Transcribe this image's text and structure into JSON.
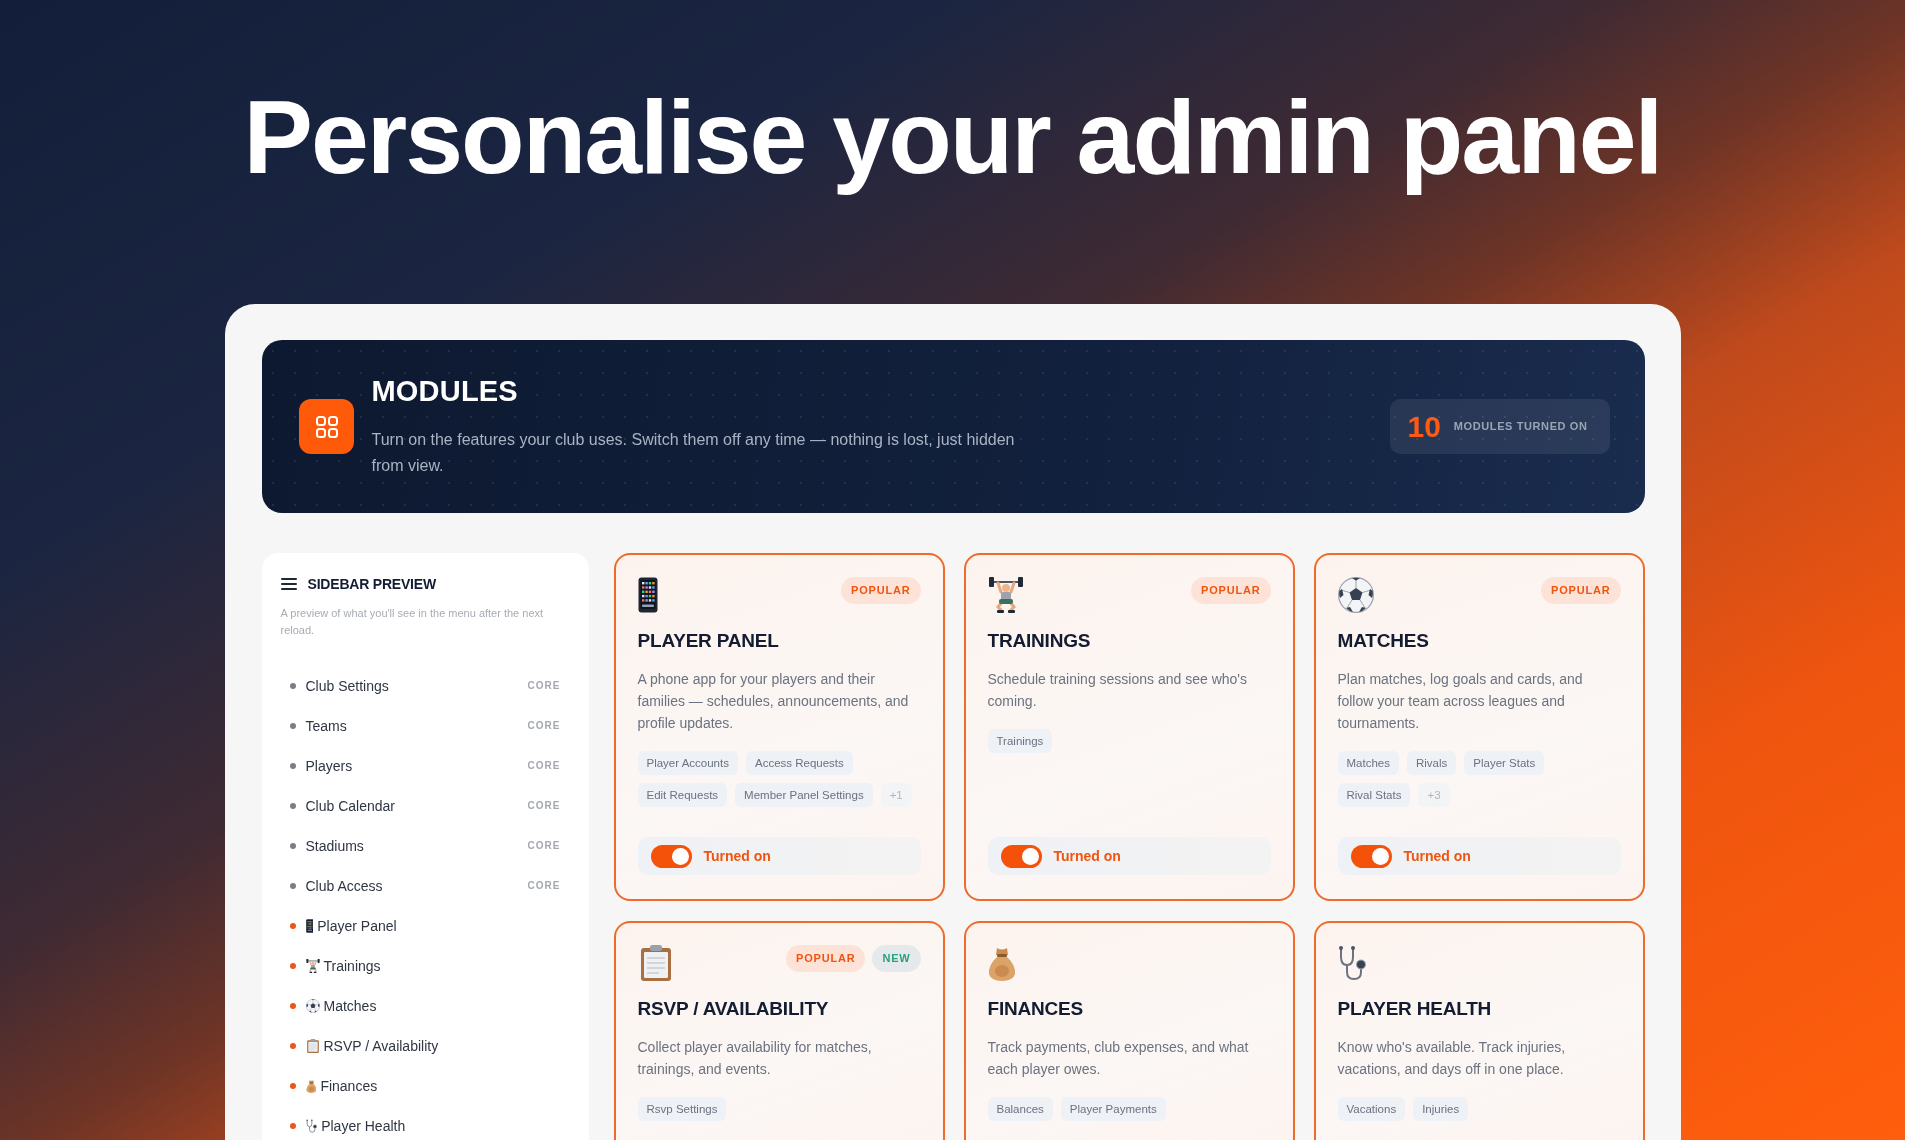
{
  "headline": "Personalise your admin panel",
  "banner": {
    "title": "MODULES",
    "description": "Turn on the features your club uses. Switch them off any time — nothing is lost, just hidden from view.",
    "count": "10",
    "count_label": "MODULES TURNED ON"
  },
  "sidebar": {
    "title": "SIDEBAR PREVIEW",
    "description": "A preview of what you'll see in the menu after the next reload.",
    "items": [
      {
        "label": "Club Settings",
        "kind": "core",
        "badge": "CORE",
        "color": "#7a7f87"
      },
      {
        "label": "Teams",
        "kind": "core",
        "badge": "CORE",
        "color": "#7a7f87"
      },
      {
        "label": "Players",
        "kind": "core",
        "badge": "CORE",
        "color": "#7a7f87"
      },
      {
        "label": "Club Calendar",
        "kind": "core",
        "badge": "CORE",
        "color": "#7a7f87"
      },
      {
        "label": "Stadiums",
        "kind": "core",
        "badge": "CORE",
        "color": "#7a7f87"
      },
      {
        "label": "Club Access",
        "kind": "core",
        "badge": "CORE",
        "color": "#7a7f87"
      },
      {
        "label": "Player Panel",
        "kind": "module",
        "color": "#f0541a"
      },
      {
        "label": "Trainings",
        "kind": "module",
        "color": "#f0541a"
      },
      {
        "label": "Matches",
        "kind": "module",
        "color": "#f0541a"
      },
      {
        "label": "RSVP / Availability",
        "kind": "module",
        "color": "#f0541a"
      },
      {
        "label": "Finances",
        "kind": "module",
        "color": "#f0541a"
      },
      {
        "label": "Player Health",
        "kind": "module",
        "color": "#f0541a"
      }
    ]
  },
  "modules": [
    {
      "title": "PLAYER PANEL",
      "badges": [
        {
          "label": "POPULAR",
          "kind": "popular"
        }
      ],
      "description": "A phone app for your players and their families — schedules, announcements, and profile updates.",
      "tags": [
        "Player Accounts",
        "Access Requests",
        "Edit Requests",
        "Member Panel Settings"
      ],
      "more_tags": "+1",
      "toggle": {
        "on": true,
        "label": "Turned on"
      }
    },
    {
      "title": "TRAININGS",
      "badges": [
        {
          "label": "POPULAR",
          "kind": "popular"
        }
      ],
      "description": "Schedule training sessions and see who's coming.",
      "tags": [
        "Trainings"
      ],
      "toggle": {
        "on": true,
        "label": "Turned on"
      }
    },
    {
      "title": "MATCHES",
      "badges": [
        {
          "label": "POPULAR",
          "kind": "popular"
        }
      ],
      "description": "Plan matches, log goals and cards, and follow your team across leagues and tournaments.",
      "tags": [
        "Matches",
        "Rivals",
        "Player Stats",
        "Rival Stats"
      ],
      "more_tags": "+3",
      "toggle": {
        "on": true,
        "label": "Turned on"
      }
    },
    {
      "title": "RSVP / AVAILABILITY",
      "badges": [
        {
          "label": "POPULAR",
          "kind": "popular"
        },
        {
          "label": "NEW",
          "kind": "new"
        }
      ],
      "description": "Collect player availability for matches, trainings, and events.",
      "tags": [
        "Rsvp Settings"
      ]
    },
    {
      "title": "FINANCES",
      "description": "Track payments, club expenses, and what each player owes.",
      "tags": [
        "Balances",
        "Player Payments"
      ]
    },
    {
      "title": "PLAYER HEALTH",
      "description": "Know who's available. Track injuries, vacations, and days off in one place.",
      "tags": [
        "Vacations",
        "Injuries"
      ]
    }
  ]
}
